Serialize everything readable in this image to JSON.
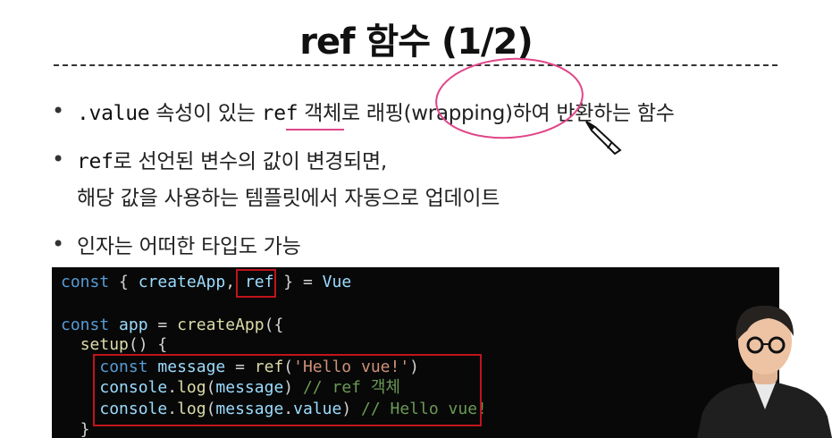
{
  "title": "ref 함수 (1/2)",
  "bullets": [
    {
      "code1": ".value",
      "text1": " 속성이 있는 ",
      "code2": "ref",
      "text2": " 객체로 래핑(wrapping)하여 반환하는 함수"
    },
    {
      "code1": "ref",
      "text1": "로 선언된 변수의 값이 변경되면,",
      "line2": "해당 값을 사용하는 템플릿에서 자동으로 업데이트"
    },
    {
      "text1": "인자는 어떠한 타입도 가능"
    }
  ],
  "bullet_symbol": "•",
  "code": {
    "l1": {
      "a": "const",
      "b": " { ",
      "c": "createApp",
      "d": ", ",
      "e": "ref",
      "f": " } = ",
      "g": "Vue"
    },
    "l3": {
      "a": "const",
      "b": " ",
      "c": "app",
      "d": " = ",
      "e": "createApp",
      "f": "({"
    },
    "l4": {
      "a": "  ",
      "b": "setup",
      "c": "() {"
    },
    "l5": {
      "a": "    ",
      "b": "const",
      "c": " ",
      "d": "message",
      "e": " = ",
      "f": "ref",
      "g": "(",
      "h": "'Hello vue!'",
      "i": ")"
    },
    "l6": {
      "a": "    ",
      "b": "console",
      "c": ".",
      "d": "log",
      "e": "(",
      "f": "message",
      "g": ") ",
      "h": "// ref 객체"
    },
    "l7": {
      "a": "    ",
      "b": "console",
      "c": ".",
      "d": "log",
      "e": "(",
      "f": "message",
      "g": ".",
      "h": "value",
      "i": ") ",
      "j": "// Hello vue!"
    },
    "l8": {
      "a": "  }"
    }
  },
  "colors": {
    "annotation_pink": "#e0458a",
    "highlight_red": "#c0141c",
    "code_bg": "#080808"
  },
  "icons": [
    "pencil-cursor-icon"
  ]
}
